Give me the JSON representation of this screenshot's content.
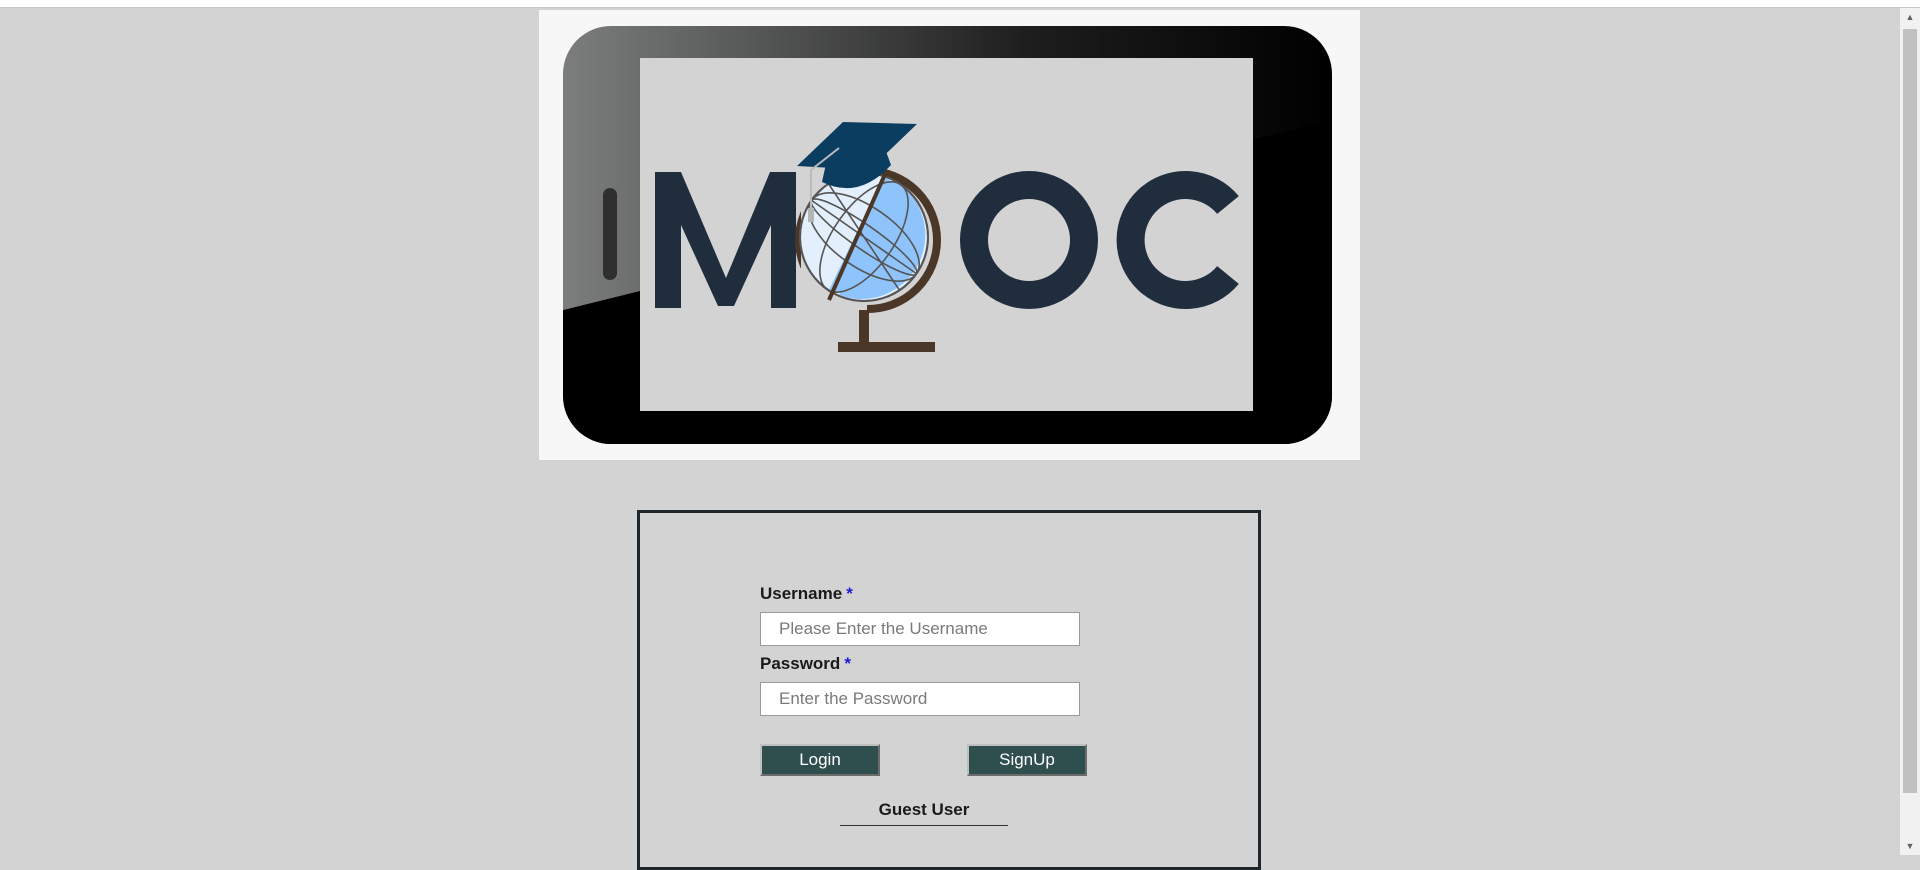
{
  "banner": {
    "logo_text": "MOOC",
    "colors": {
      "phone_body": "#000000",
      "screen": "#d3d3d3",
      "letters": "#1f2d3d",
      "globe_light": "#e3effc",
      "globe_blue": "#8fc3fb",
      "globe_stand": "#4a3728",
      "cap": "#0b3d61"
    }
  },
  "form": {
    "username_label": "Username",
    "password_label": "Password",
    "required_mark": "*",
    "username_placeholder": "Please Enter the Username",
    "password_placeholder": "Enter the Password",
    "login_label": "Login",
    "signup_label": "SignUp",
    "guest_label": "Guest User"
  },
  "colors": {
    "background": "#d3d3d3",
    "button": "#2f4f4f",
    "required": "#1b1bd6",
    "box_border": "#1f262b"
  }
}
